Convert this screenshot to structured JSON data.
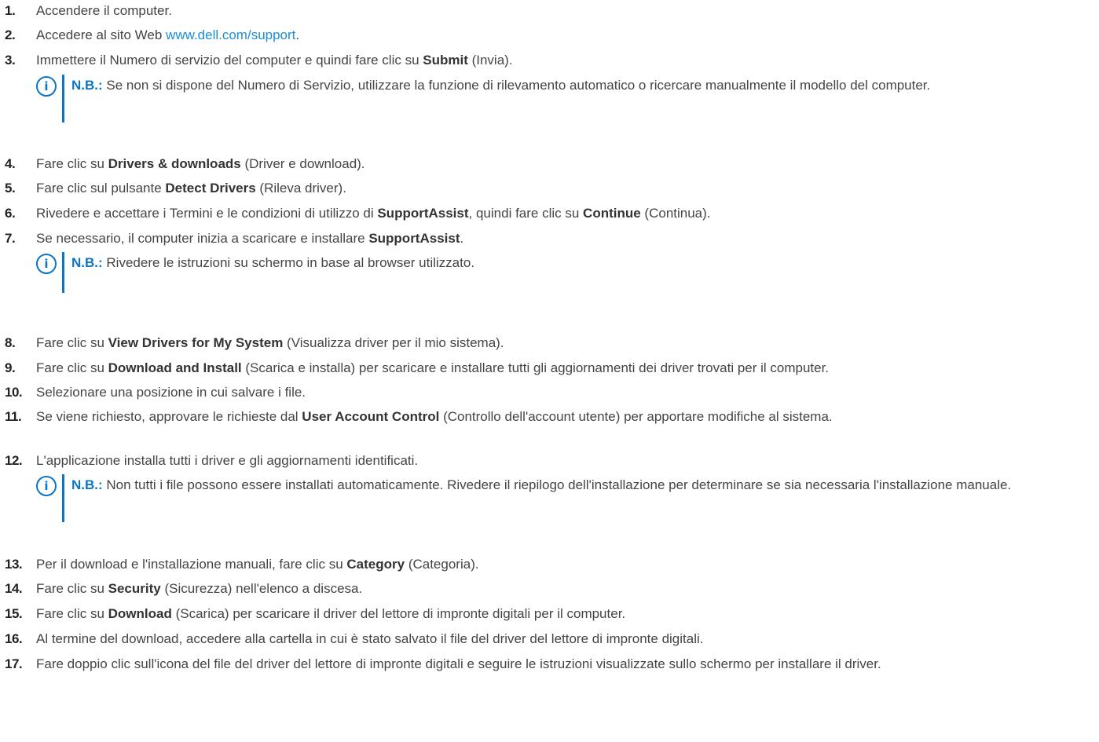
{
  "steps": [
    {
      "num": "1.",
      "parts": [
        {
          "t": "Accendere il computer."
        }
      ]
    },
    {
      "num": "2.",
      "parts": [
        {
          "t": "Accedere al sito Web "
        },
        {
          "t": "www.dell.com/support",
          "link": true
        },
        {
          "t": "."
        }
      ]
    },
    {
      "num": "3.",
      "parts": [
        {
          "t": "Immettere il Numero di servizio del computer e quindi fare clic su "
        },
        {
          "t": "Submit",
          "b": true
        },
        {
          "t": " (Invia)."
        }
      ]
    },
    {
      "num": "4.",
      "parts": [
        {
          "t": "Fare clic su "
        },
        {
          "t": "Drivers & downloads",
          "b": true
        },
        {
          "t": " (Driver e download)."
        }
      ]
    },
    {
      "num": "5.",
      "parts": [
        {
          "t": "Fare clic sul pulsante "
        },
        {
          "t": "Detect Drivers",
          "b": true
        },
        {
          "t": " (Rileva driver)."
        }
      ]
    },
    {
      "num": "6.",
      "parts": [
        {
          "t": "Rivedere e accettare i Termini e le condizioni di utilizzo di "
        },
        {
          "t": "SupportAssist",
          "b": true
        },
        {
          "t": ", quindi fare clic su "
        },
        {
          "t": "Continue",
          "b": true
        },
        {
          "t": " (Continua)."
        }
      ]
    },
    {
      "num": "7.",
      "parts": [
        {
          "t": "Se necessario, il computer inizia a scaricare e installare "
        },
        {
          "t": "SupportAssist",
          "b": true
        },
        {
          "t": "."
        }
      ]
    },
    {
      "num": "8.",
      "parts": [
        {
          "t": "Fare clic su "
        },
        {
          "t": "View Drivers for My System",
          "b": true
        },
        {
          "t": " (Visualizza driver per il mio sistema)."
        }
      ]
    },
    {
      "num": "9.",
      "parts": [
        {
          "t": "Fare clic su "
        },
        {
          "t": "Download and Install",
          "b": true
        },
        {
          "t": " (Scarica e installa) per scaricare e installare tutti gli aggiornamenti dei driver trovati per il computer."
        }
      ]
    },
    {
      "num": "10.",
      "parts": [
        {
          "t": "Selezionare una posizione in cui salvare i file."
        }
      ]
    },
    {
      "num": "11.",
      "parts": [
        {
          "t": "Se viene richiesto, approvare le richieste dal "
        },
        {
          "t": "User Account Control",
          "b": true
        },
        {
          "t": " (Controllo dell'account utente) per apportare modifiche al sistema."
        }
      ]
    },
    {
      "num": "12.",
      "parts": [
        {
          "t": "L'applicazione installa tutti i driver e gli aggiornamenti identificati."
        }
      ]
    },
    {
      "num": "13.",
      "parts": [
        {
          "t": "Per il download e l'installazione manuali, fare clic su "
        },
        {
          "t": "Category",
          "b": true
        },
        {
          "t": " (Categoria)."
        }
      ]
    },
    {
      "num": "14.",
      "parts": [
        {
          "t": "Fare clic su "
        },
        {
          "t": "Security",
          "b": true
        },
        {
          "t": " (Sicurezza) nell'elenco a discesa."
        }
      ]
    },
    {
      "num": "15.",
      "parts": [
        {
          "t": "Fare clic su "
        },
        {
          "t": "Download",
          "b": true
        },
        {
          "t": " (Scarica) per scaricare il driver del lettore di impronte digitali per il computer."
        }
      ]
    },
    {
      "num": "16.",
      "parts": [
        {
          "t": "Al termine del download, accedere alla cartella in cui è stato salvato il file del driver del lettore di impronte digitali."
        }
      ]
    },
    {
      "num": "17.",
      "parts": [
        {
          "t": "Fare doppio clic sull'icona del file del driver del lettore di impronte digitali e seguire le istruzioni visualizzate sullo schermo per installare il driver."
        }
      ]
    }
  ],
  "notes": [
    {
      "label": "N.B.:",
      "text": " Se non si dispone del Numero di Servizio, utilizzare la funzione di rilevamento automatico o ricercare manualmente il modello del computer.",
      "icon": "info-icon"
    },
    {
      "label": "N.B.:",
      "text": " Rivedere le istruzioni su schermo in base al browser utilizzato.",
      "icon": "info-icon"
    },
    {
      "label": "N.B.:",
      "text": " Non tutti i file possono essere installati automaticamente. Rivedere il riepilogo dell'installazione per determinare se sia necessaria l'installazione manuale.",
      "icon": "info-icon"
    }
  ],
  "colors": {
    "link": "#1a8fd6",
    "note_accent": "#0b75c9",
    "text": "#444444"
  }
}
